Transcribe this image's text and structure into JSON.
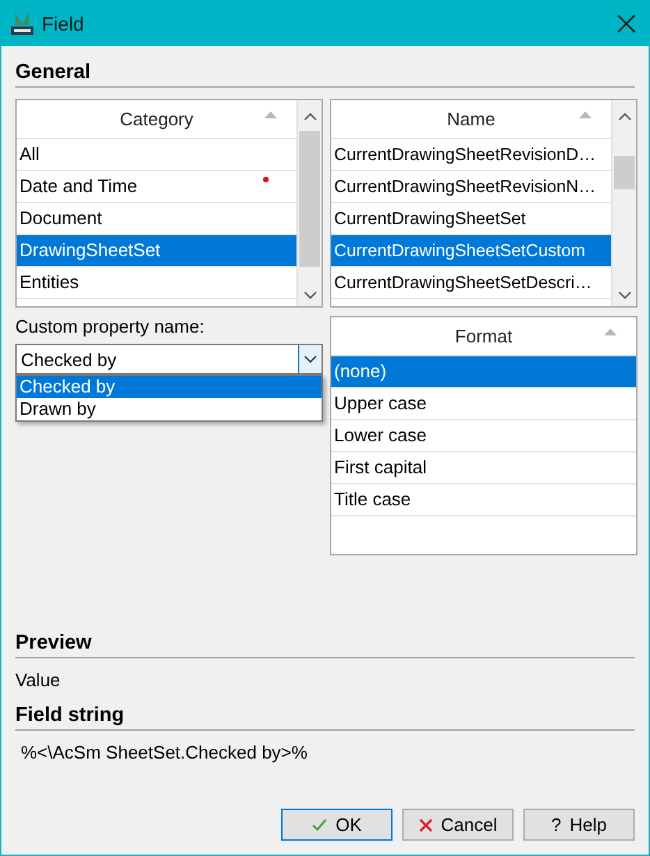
{
  "window": {
    "title": "Field"
  },
  "general": {
    "heading": "General",
    "category_list": {
      "header": "Category",
      "items": [
        {
          "label": "All",
          "selected": false,
          "flagged": false
        },
        {
          "label": "Date and Time",
          "selected": false,
          "flagged": true
        },
        {
          "label": "Document",
          "selected": false,
          "flagged": false
        },
        {
          "label": "DrawingSheetSet",
          "selected": true,
          "flagged": false
        },
        {
          "label": "Entities",
          "selected": false,
          "flagged": false
        }
      ]
    },
    "name_list": {
      "header": "Name",
      "items": [
        {
          "label": "CurrentDrawingSheetRevisionD…",
          "selected": false
        },
        {
          "label": "CurrentDrawingSheetRevisionN…",
          "selected": false
        },
        {
          "label": "CurrentDrawingSheetSet",
          "selected": false
        },
        {
          "label": "CurrentDrawingSheetSetCustom",
          "selected": true
        },
        {
          "label": "CurrentDrawingSheetSetDescri…",
          "selected": false
        }
      ]
    },
    "custom_property": {
      "label": "Custom property name:",
      "value": "Checked by",
      "expanded": true,
      "options": [
        {
          "label": "Checked by",
          "selected": true
        },
        {
          "label": "Drawn by",
          "selected": false
        }
      ]
    },
    "format_list": {
      "header": "Format",
      "items": [
        {
          "label": "(none)",
          "selected": true
        },
        {
          "label": "Upper case",
          "selected": false
        },
        {
          "label": "Lower case",
          "selected": false
        },
        {
          "label": "First capital",
          "selected": false
        },
        {
          "label": "Title case",
          "selected": false
        }
      ]
    }
  },
  "preview": {
    "heading": "Preview",
    "value": "Value"
  },
  "field_string": {
    "heading": "Field string",
    "value": "%<\\AcSm SheetSet.Checked by>%"
  },
  "buttons": [
    {
      "kind": "ok",
      "label": "OK"
    },
    {
      "kind": "cancel",
      "label": "Cancel"
    },
    {
      "kind": "help",
      "label": "Help",
      "icon_text": "?"
    }
  ]
}
